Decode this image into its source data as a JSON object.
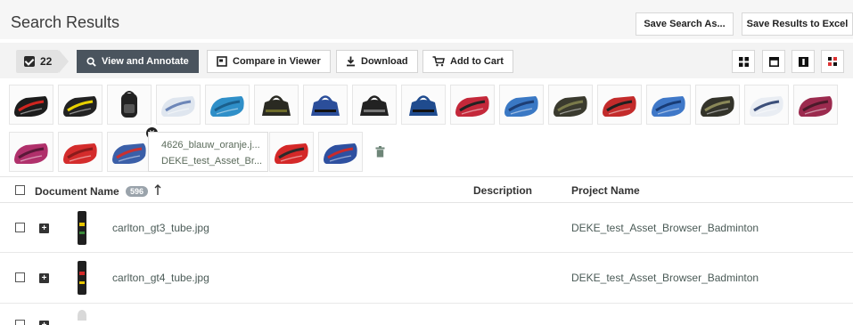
{
  "header": {
    "title": "Search Results",
    "save_search_label": "Save Search As...",
    "save_excel_label": "Save Results to Excel"
  },
  "toolbar": {
    "selected_count": "22",
    "view_annotate_label": "View and Annotate",
    "compare_label": "Compare in Viewer",
    "download_label": "Download",
    "add_cart_label": "Add to Cart",
    "view_modes": [
      "grid-view-icon",
      "single-view-icon",
      "detail-view-icon",
      "compare-view-icon"
    ]
  },
  "selected_assets": {
    "thumbnails": [
      {
        "icon": "racket-bag-icon",
        "color": "#1c1c1c",
        "accent": "#d0251f"
      },
      {
        "icon": "racket-bag-icon",
        "color": "#222222",
        "accent": "#e8d100"
      },
      {
        "icon": "backpack-icon",
        "color": "#222222",
        "accent": "#555555"
      },
      {
        "icon": "racket-bag-icon",
        "color": "#dfe6ef",
        "accent": "#6c86b8"
      },
      {
        "icon": "racket-bag-icon",
        "color": "#2f8fc8",
        "accent": "#1b5f8c"
      },
      {
        "icon": "duffel-bag-icon",
        "color": "#2a2a22",
        "accent": "#6d6b2a"
      },
      {
        "icon": "duffel-bag-icon",
        "color": "#2b4e9a",
        "accent": "#111111"
      },
      {
        "icon": "duffel-bag-icon",
        "color": "#222222",
        "accent": "#777777"
      },
      {
        "icon": "duffel-bag-icon",
        "color": "#1f4b8e",
        "accent": "#111111"
      },
      {
        "icon": "racket-bag-icon",
        "color": "#c4283a",
        "accent": "#222222"
      },
      {
        "icon": "racket-bag-icon",
        "color": "#3a78c4",
        "accent": "#1d3e74"
      },
      {
        "icon": "racket-bag-icon",
        "color": "#3a3a2e",
        "accent": "#7a7a4a"
      },
      {
        "icon": "racket-bag-icon",
        "color": "#c32b2b",
        "accent": "#202020"
      },
      {
        "icon": "racket-bag-icon",
        "color": "#3f78c8",
        "accent": "#183c76"
      },
      {
        "icon": "racket-bag-icon",
        "color": "#33332a",
        "accent": "#8a8858"
      },
      {
        "icon": "racket-bag-icon",
        "color": "#e9edf3",
        "accent": "#3c4f7a"
      },
      {
        "icon": "racket-bag-icon",
        "color": "#9b2a4e",
        "accent": "#4a1a2a"
      },
      {
        "icon": "racket-bag-icon",
        "color": "#b0306b",
        "accent": "#5a1838"
      },
      {
        "icon": "racket-bag-icon",
        "color": "#d42c2c",
        "accent": "#8a1b1b"
      },
      {
        "icon": "racket-bag-icon",
        "color": "#3b5fa8",
        "accent": "#c93030"
      },
      {
        "icon": "racket-bag-icon",
        "color": "#d42828",
        "accent": "#2a2a2a"
      },
      {
        "icon": "racket-bag-icon",
        "color": "#2e50a0",
        "accent": "#c92a2a"
      }
    ],
    "file_card": {
      "filename": "4626_blauw_oranje.j...",
      "project": "DEKE_test_Asset_Br..."
    }
  },
  "table": {
    "col_document": "Document Name",
    "doc_count": "596",
    "col_description": "Description",
    "col_project": "Project Name",
    "rows": [
      {
        "name": "carlton_gt3_tube.jpg",
        "description": "",
        "project": "DEKE_test_Asset_Browser_Badminton"
      },
      {
        "name": "carlton_gt4_tube.jpg",
        "description": "",
        "project": "DEKE_test_Asset_Browser_Badminton"
      }
    ]
  },
  "colors": {
    "dark_button": "#4a545e",
    "text_green": "#4b5b57",
    "header_bg": "#f6f6f6"
  }
}
